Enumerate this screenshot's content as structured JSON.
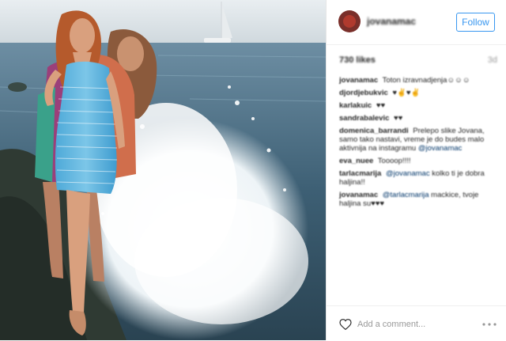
{
  "post": {
    "username": "jovanamac",
    "follow_label": "Follow",
    "likes": "730 likes",
    "age": "3d",
    "add_comment_placeholder": "Add a comment...",
    "comments": [
      {
        "user": "jovanamac",
        "text": "Toton izravnadjenja☺☺☺"
      },
      {
        "user": "djordjebukvic",
        "text": "♥✌♥✌"
      },
      {
        "user": "karlakuic",
        "text": "♥♥"
      },
      {
        "user": "sandrabalevic",
        "text": "♥♥"
      },
      {
        "user": "domenica_barrandi",
        "text": "Prelepo slike Jovana, samo tako nastavi, vreme je do budes malo aktivnija na instagramu",
        "mention": "@jovanamac"
      },
      {
        "user": "eva_nuee",
        "text": "Toooop!!!!"
      },
      {
        "user": "tarlacmarija",
        "mention": "@jovanamac",
        "text": "kolko ti je dobra haljina!!"
      },
      {
        "user": "jovanamac",
        "mention": "@tarlacmarija",
        "text": "mackice, tvoje haljina su♥♥♥"
      }
    ]
  },
  "colors": {
    "accent": "#3897f0",
    "text": "#262626",
    "muted": "#999999",
    "mention": "#003569"
  },
  "icons": {
    "heart": "heart-icon",
    "more": "more-icon"
  }
}
